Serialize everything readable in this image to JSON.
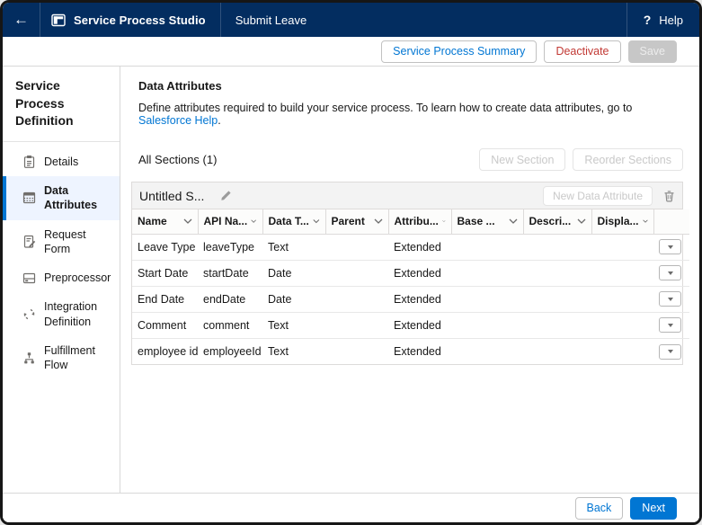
{
  "navbar": {
    "back_icon": "←",
    "app_title": "Service Process Studio",
    "record_tab": "Submit Leave",
    "help_icon": "?",
    "help_label": "Help"
  },
  "toolbar": {
    "summary_button": "Service Process Summary",
    "deactivate_button": "Deactivate",
    "save_button": "Save"
  },
  "sidebar": {
    "title": "Service Process Definition",
    "items": [
      {
        "label": "Details",
        "icon": "clipboard-icon",
        "selected": false
      },
      {
        "label": "Data Attributes",
        "icon": "table-icon",
        "selected": true
      },
      {
        "label": "Request Form",
        "icon": "form-icon",
        "selected": false
      },
      {
        "label": "Preprocessor",
        "icon": "preprocessor-icon",
        "selected": false
      },
      {
        "label": "Integration Definition",
        "icon": "integration-icon",
        "selected": false
      },
      {
        "label": "Fulfillment Flow",
        "icon": "flow-icon",
        "selected": false
      }
    ]
  },
  "main": {
    "title": "Data Attributes",
    "description_text": "Define attributes required to build your service process. To learn how to create data attributes, go to ",
    "description_link": "Salesforce Help",
    "description_suffix": ".",
    "sections_label": "All Sections (1)",
    "new_section_button": "New Section",
    "reorder_sections_button": "Reorder Sections",
    "section": {
      "title": "Untitled S...",
      "new_attribute_button": "New Data Attribute"
    },
    "table": {
      "columns": [
        "Name",
        "API Na...",
        "Data T...",
        "Parent",
        "Attribu...",
        "Base ...",
        "Descri...",
        "Displa..."
      ],
      "rows": [
        {
          "name": "Leave Type",
          "api_name": "leaveType",
          "data_type": "Text",
          "parent": "",
          "attribute": "Extended",
          "base": "",
          "description": "",
          "display": ""
        },
        {
          "name": "Start Date",
          "api_name": "startDate",
          "data_type": "Date",
          "parent": "",
          "attribute": "Extended",
          "base": "",
          "description": "",
          "display": ""
        },
        {
          "name": "End Date",
          "api_name": "endDate",
          "data_type": "Date",
          "parent": "",
          "attribute": "Extended",
          "base": "",
          "description": "",
          "display": ""
        },
        {
          "name": "Comment",
          "api_name": "comment",
          "data_type": "Text",
          "parent": "",
          "attribute": "Extended",
          "base": "",
          "description": "",
          "display": ""
        },
        {
          "name": "employee id",
          "api_name": "employeeId",
          "data_type": "Text",
          "parent": "",
          "attribute": "Extended",
          "base": "",
          "description": "",
          "display": ""
        }
      ]
    }
  },
  "footer": {
    "back_button": "Back",
    "next_button": "Next"
  },
  "colors": {
    "navbar_bg": "#032D60",
    "accent_blue": "#0176D3",
    "destructive_red": "#C23934",
    "selected_item_bg": "#EEF4FF"
  }
}
